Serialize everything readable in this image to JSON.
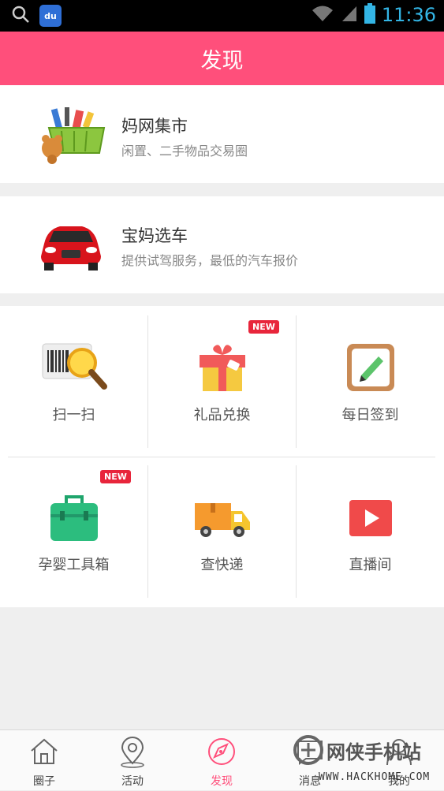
{
  "status_bar": {
    "time": "11:36",
    "baidu_label": "du"
  },
  "header": {
    "title": "发现"
  },
  "cards": [
    {
      "title": "妈网集市",
      "subtitle": "闲置、二手物品交易圈"
    },
    {
      "title": "宝妈选车",
      "subtitle": "提供试驾服务，最低的汽车报价"
    }
  ],
  "grid": {
    "items": [
      {
        "label": "扫一扫",
        "badge": ""
      },
      {
        "label": "礼品兑换",
        "badge": "NEW"
      },
      {
        "label": "每日签到",
        "badge": ""
      },
      {
        "label": "孕婴工具箱",
        "badge": "NEW"
      },
      {
        "label": "查快递",
        "badge": ""
      },
      {
        "label": "直播间",
        "badge": ""
      }
    ]
  },
  "tabbar": {
    "tabs": [
      {
        "label": "圈子",
        "icon": "home-icon"
      },
      {
        "label": "活动",
        "icon": "location-pin-icon"
      },
      {
        "label": "发现",
        "icon": "discover-icon",
        "active": true
      },
      {
        "label": "消息",
        "icon": "message-icon"
      },
      {
        "label": "我的",
        "icon": "profile-icon"
      }
    ]
  },
  "watermark": {
    "text": "网侠手机站",
    "url": "WWW.HACKHOME.COM"
  },
  "colors": {
    "accent": "#ff4f7b",
    "badge": "#e8253b",
    "statusbar_text": "#33b5e5"
  }
}
